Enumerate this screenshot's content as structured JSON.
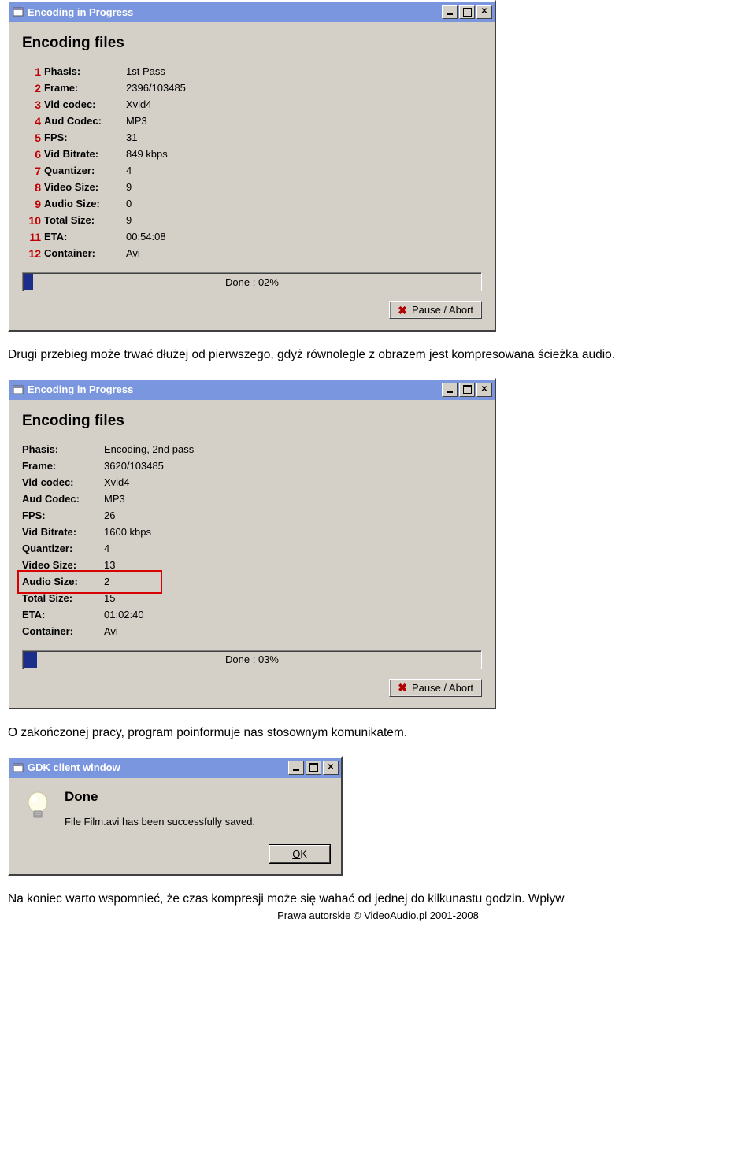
{
  "win1": {
    "title": "Encoding in Progress",
    "heading": "Encoding files",
    "rows": [
      {
        "num": "1",
        "label": "Phasis:",
        "value": "1st Pass"
      },
      {
        "num": "2",
        "label": "Frame:",
        "value": "2396/103485"
      },
      {
        "num": "3",
        "label": "Vid codec:",
        "value": "Xvid4"
      },
      {
        "num": "4",
        "label": "Aud Codec:",
        "value": "MP3"
      },
      {
        "num": "5",
        "label": "FPS:",
        "value": "31"
      },
      {
        "num": "6",
        "label": "Vid Bitrate:",
        "value": "849 kbps"
      },
      {
        "num": "7",
        "label": "Quantizer:",
        "value": "4"
      },
      {
        "num": "8",
        "label": "Video Size:",
        "value": "9"
      },
      {
        "num": "9",
        "label": "Audio Size:",
        "value": "0"
      },
      {
        "num": "10",
        "label": "Total Size:",
        "value": "9"
      },
      {
        "num": "11",
        "label": "ETA:",
        "value": "00:54:08"
      },
      {
        "num": "12",
        "label": "Container:",
        "value": "Avi"
      }
    ],
    "progress_text": "Done : 02%",
    "progress_pct": 2,
    "pause_label": "Pause / Abort"
  },
  "para1": "Drugi przebieg może trwać dłużej od pierwszego, gdyż równolegle z obrazem jest kompresowana ścieżka audio.",
  "win2": {
    "title": "Encoding in Progress",
    "heading": "Encoding files",
    "rows": [
      {
        "label": "Phasis:",
        "value": "Encoding, 2nd pass"
      },
      {
        "label": "Frame:",
        "value": "3620/103485"
      },
      {
        "label": "Vid codec:",
        "value": "Xvid4"
      },
      {
        "label": "Aud Codec:",
        "value": "MP3"
      },
      {
        "label": "FPS:",
        "value": "26"
      },
      {
        "label": "Vid Bitrate:",
        "value": "1600 kbps"
      },
      {
        "label": "Quantizer:",
        "value": "4"
      },
      {
        "label": "Video Size:",
        "value": "13"
      },
      {
        "label": "Audio Size:",
        "value": "2"
      },
      {
        "label": "Total Size:",
        "value": "15"
      },
      {
        "label": "ETA:",
        "value": "01:02:40"
      },
      {
        "label": "Container:",
        "value": "Avi"
      }
    ],
    "progress_text": "Done : 03%",
    "progress_pct": 3,
    "pause_label": "Pause / Abort",
    "highlight_row_index": 8
  },
  "para2": "O zakończonej pracy, program poinformuje nas stosownym komunikatem.",
  "win3": {
    "title": "GDK client window",
    "done_title": "Done",
    "done_msg": "File Film.avi has been successfully saved.",
    "ok_label_pre": "",
    "ok_underline": "O",
    "ok_label_post": "K"
  },
  "para3": "Na koniec warto wspomnieć, że czas kompresji może się wahać od jednej do kilkunastu godzin. Wpływ",
  "footer": "Prawa autorskie © VideoAudio.pl 2001-2008"
}
